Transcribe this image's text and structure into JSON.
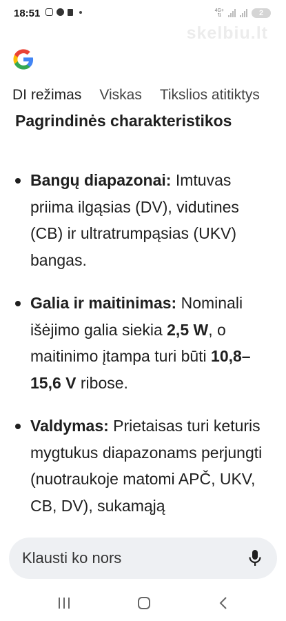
{
  "status": {
    "time": "18:51",
    "network_label": "4G+",
    "battery": "2",
    "watermark": "skelbiu.lt"
  },
  "tabs": [
    {
      "label": "DI režimas",
      "active": true
    },
    {
      "label": "Viskas",
      "active": false
    },
    {
      "label": "Tikslios atitiktys",
      "active": false
    }
  ],
  "content": {
    "heading": "Pagrindinės charakteristikos",
    "features": [
      {
        "title": "Bangų diapazonai:",
        "parts": [
          {
            "text": " Imtuvas priima ilgąsias (DV), vidutines (CB) ir ultratrumpąsias (UKV) bangas.",
            "bold": false
          }
        ]
      },
      {
        "title": "Galia ir maitinimas:",
        "parts": [
          {
            "text": " Nominali išėjimo galia siekia ",
            "bold": false
          },
          {
            "text": "2,5 W",
            "bold": true
          },
          {
            "text": ", o maitinimo įtampa turi būti ",
            "bold": false
          },
          {
            "text": "10,8–15,6 V",
            "bold": true
          },
          {
            "text": " ribose.",
            "bold": false
          }
        ]
      },
      {
        "title": "Valdymas:",
        "parts": [
          {
            "text": " Prietaisas turi keturis mygtukus diapazonams perjungti (nuotraukoje matomi APČ, UKV, CB, DV), sukamąją",
            "bold": false
          }
        ]
      }
    ]
  },
  "ask": {
    "placeholder": "Klausti ko nors"
  },
  "colors": {
    "google_blue": "#4285F4",
    "google_red": "#EA4335",
    "google_yellow": "#FBBC05",
    "google_green": "#34A853",
    "text": "#1f1f1f"
  }
}
